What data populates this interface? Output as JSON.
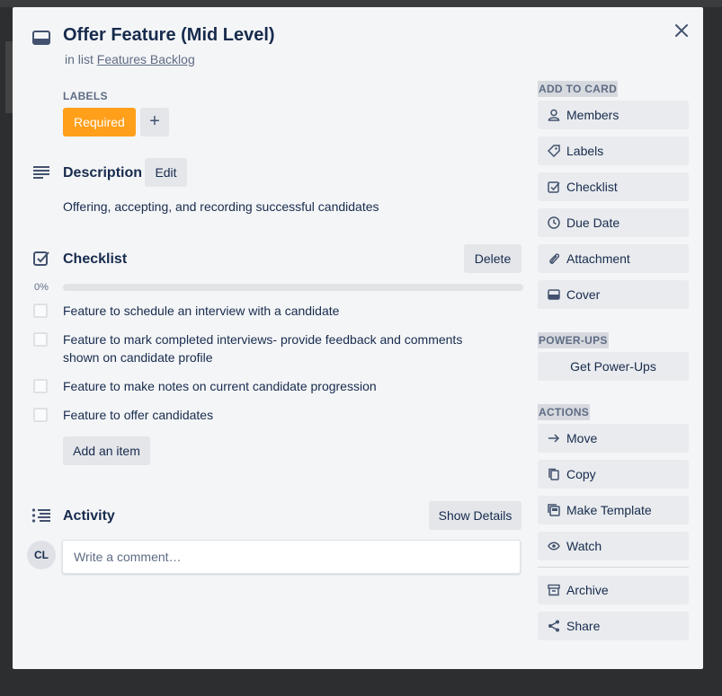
{
  "card": {
    "title": "Offer Feature (Mid Level)",
    "in_list_prefix": "in list",
    "list_name": "Features Backlog"
  },
  "labels": {
    "heading": "LABELS",
    "items": [
      {
        "text": "Required",
        "color": "#ff9f1a"
      }
    ],
    "add_symbol": "+"
  },
  "description": {
    "heading": "Description",
    "edit_label": "Edit",
    "text": "Offering, accepting, and recording successful candidates"
  },
  "checklist": {
    "heading": "Checklist",
    "delete_label": "Delete",
    "progress_text": "0%",
    "progress_fraction": 0,
    "items": [
      {
        "text": "Feature to schedule an interview with a candidate",
        "checked": false
      },
      {
        "text": "Feature to mark completed interviews- provide feedback and comments shown on candidate profile",
        "checked": false
      },
      {
        "text": "Feature to make notes on current candidate progression",
        "checked": false
      },
      {
        "text": "Feature to offer candidates",
        "checked": false
      }
    ],
    "add_item_label": "Add an item"
  },
  "activity": {
    "heading": "Activity",
    "show_details_label": "Show Details",
    "avatar_initials": "CL",
    "comment_placeholder": "Write a comment…"
  },
  "sidebar": {
    "add_to_card": {
      "heading": "ADD TO CARD",
      "items": [
        {
          "label": "Members",
          "icon": "person-icon"
        },
        {
          "label": "Labels",
          "icon": "tag-icon"
        },
        {
          "label": "Checklist",
          "icon": "checkbox-icon"
        },
        {
          "label": "Due Date",
          "icon": "clock-icon"
        },
        {
          "label": "Attachment",
          "icon": "paperclip-icon"
        },
        {
          "label": "Cover",
          "icon": "card-cover-icon"
        }
      ]
    },
    "power_ups": {
      "heading": "POWER-UPS",
      "button_label": "Get Power-Ups"
    },
    "actions": {
      "heading": "ACTIONS",
      "items": [
        {
          "label": "Move",
          "icon": "arrow-right-icon"
        },
        {
          "label": "Copy",
          "icon": "copy-icon"
        },
        {
          "label": "Make Template",
          "icon": "template-icon"
        },
        {
          "label": "Watch",
          "icon": "eye-icon"
        },
        {
          "label": "Archive",
          "icon": "archive-icon"
        },
        {
          "label": "Share",
          "icon": "share-icon"
        }
      ]
    }
  }
}
